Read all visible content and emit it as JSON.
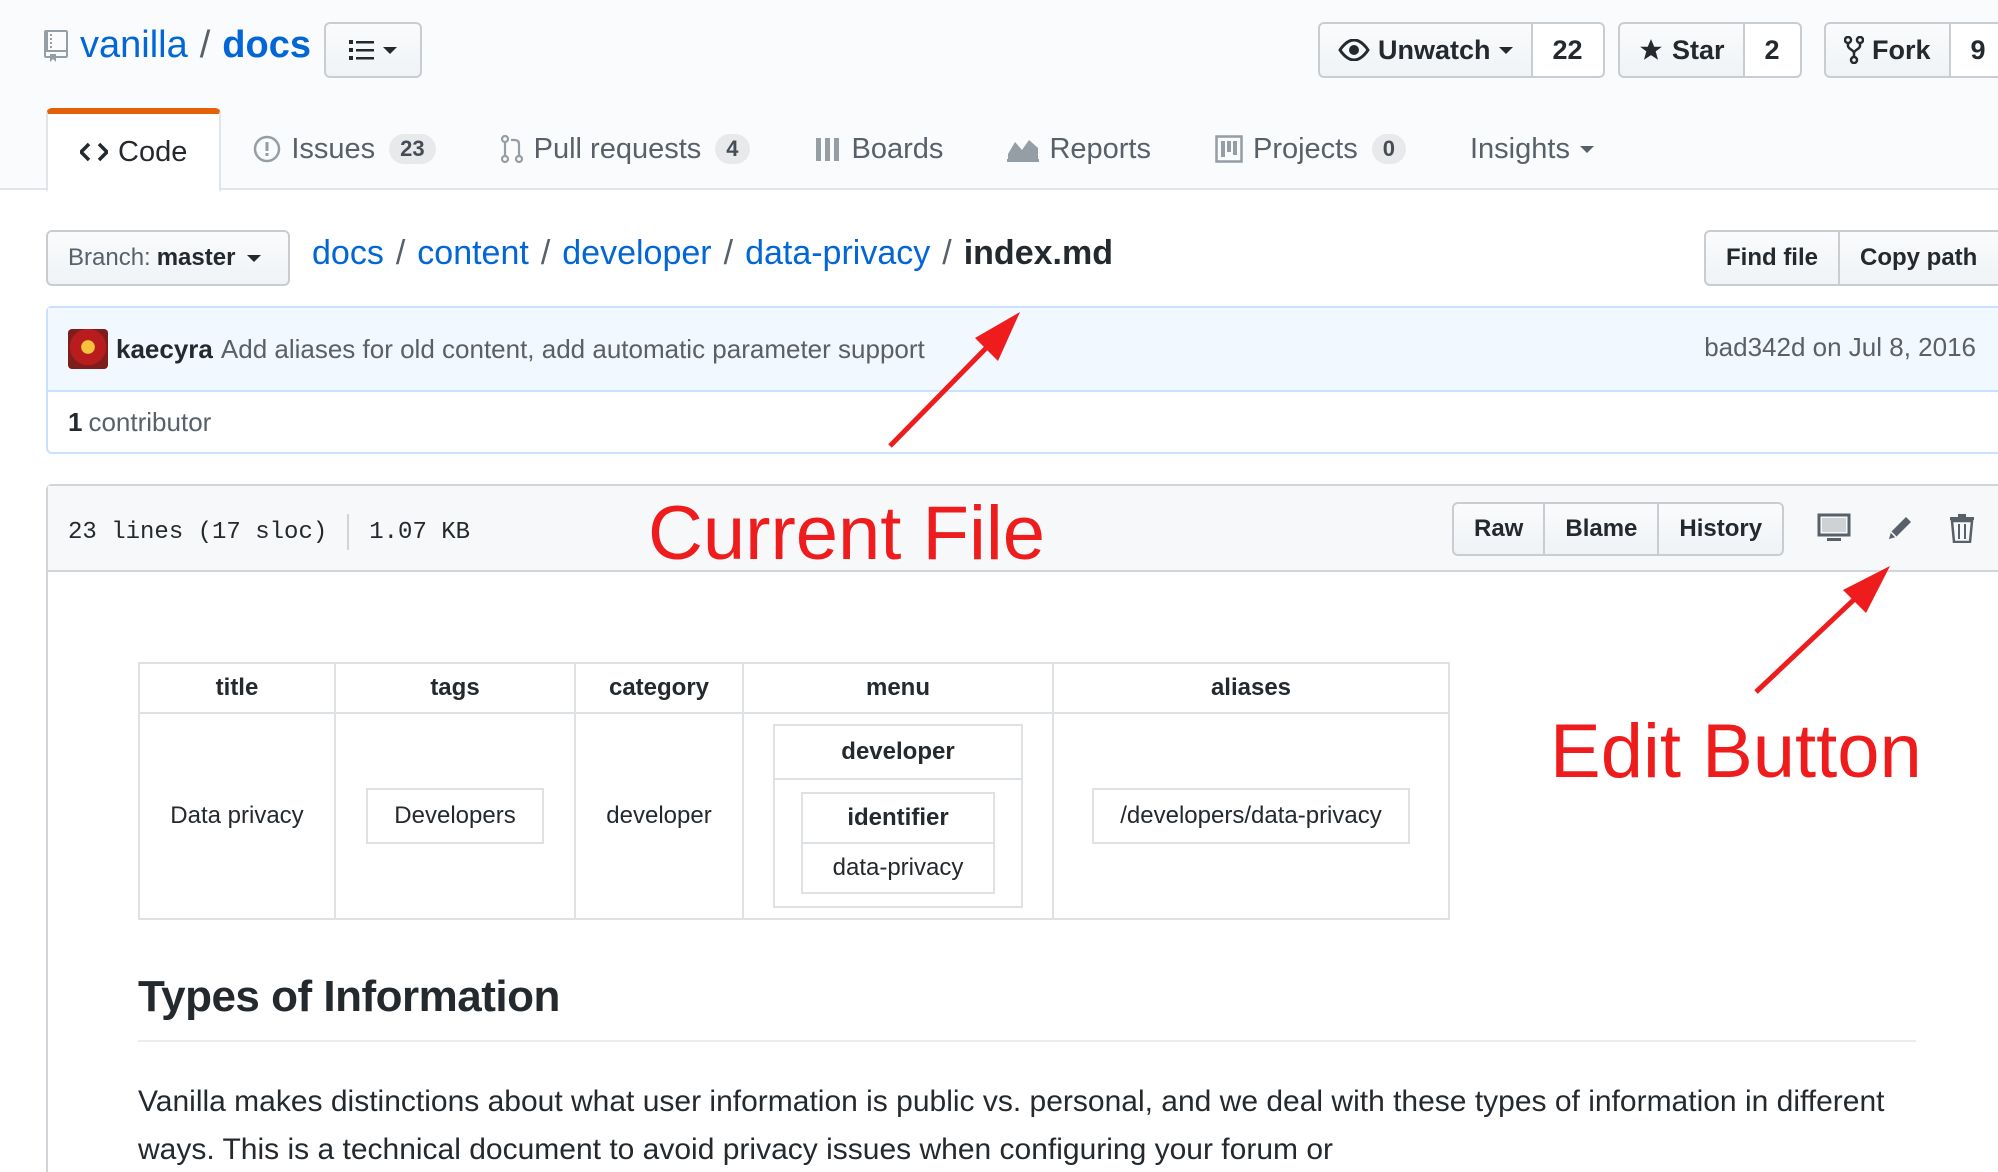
{
  "repo": {
    "owner": "vanilla",
    "name": "docs"
  },
  "social": {
    "watch": {
      "label": "Unwatch",
      "count": "22"
    },
    "star": {
      "label": "Star",
      "count": "2"
    },
    "fork": {
      "label": "Fork",
      "count": "9"
    }
  },
  "nav": {
    "tabs": [
      {
        "label": "Code",
        "icon": "code-icon",
        "selected": true
      },
      {
        "label": "Issues",
        "count": "23",
        "icon": "issue-icon"
      },
      {
        "label": "Pull requests",
        "count": "4",
        "icon": "pull-request-icon"
      },
      {
        "label": "Boards",
        "icon": "boards-icon"
      },
      {
        "label": "Reports",
        "icon": "graph-icon"
      },
      {
        "label": "Projects",
        "count": "0",
        "icon": "project-icon"
      },
      {
        "label": "Insights",
        "icon": "caret-down-icon"
      }
    ]
  },
  "branch": {
    "prefix": "Branch:",
    "name": "master"
  },
  "breadcrumb": {
    "parts": [
      "docs",
      "content",
      "developer",
      "data-privacy"
    ],
    "separator": "/",
    "file": "index.md"
  },
  "file_buttons": {
    "find": "Find file",
    "copy": "Copy path"
  },
  "commit": {
    "author": "kaecyra",
    "message": "Add aliases for old content, add automatic parameter support",
    "sha_date": "bad342d on Jul 8, 2016",
    "contributors_count": "1",
    "contributors_label": "contributor"
  },
  "file": {
    "lines": "23 lines (17 sloc)",
    "size": "1.07 KB",
    "actions": [
      "Raw",
      "Blame",
      "History"
    ]
  },
  "frontmatter": {
    "headers": [
      "title",
      "tags",
      "category",
      "menu",
      "aliases"
    ],
    "title": "Data privacy",
    "tags": "Developers",
    "category": "developer",
    "menu": {
      "key": "developer",
      "sub_key": "identifier",
      "sub_value": "data-privacy"
    },
    "aliases": "/developers/data-privacy"
  },
  "content": {
    "heading": "Types of Information",
    "paragraph": "Vanilla makes distinctions about what user information is public vs. personal, and we deal with these types of information in different ways. This is a technical document to avoid privacy issues when configuring your forum or"
  },
  "annotations": {
    "current_file": "Current File",
    "edit_button": "Edit Button",
    "color": "#ee1c1c"
  },
  "colors": {
    "link": "#0366d6",
    "tab_accent": "#e36209",
    "commit_bg": "#f1f8ff"
  }
}
